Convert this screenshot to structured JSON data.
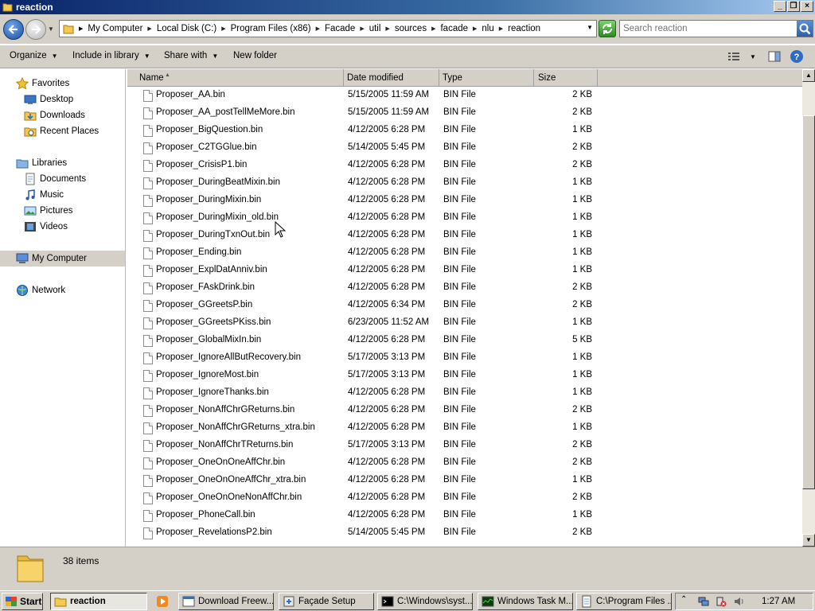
{
  "window": {
    "title": "reaction"
  },
  "address": {
    "crumbs": [
      "My Computer",
      "Local Disk (C:)",
      "Program Files (x86)",
      "Facade",
      "util",
      "sources",
      "facade",
      "nlu",
      "reaction"
    ]
  },
  "search": {
    "placeholder": "Search reaction"
  },
  "toolbar": {
    "organize": "Organize",
    "include_in_library": "Include in library",
    "share_with": "Share with",
    "new_folder": "New folder"
  },
  "nav": {
    "favorites": "Favorites",
    "desktop": "Desktop",
    "downloads": "Downloads",
    "recent_places": "Recent Places",
    "libraries": "Libraries",
    "documents": "Documents",
    "music": "Music",
    "pictures": "Pictures",
    "videos": "Videos",
    "my_computer": "My Computer",
    "network": "Network"
  },
  "columns": {
    "name": "Name",
    "date": "Date modified",
    "type": "Type",
    "size": "Size"
  },
  "files": [
    {
      "name": "Proposer_AA.bin",
      "date": "5/15/2005 11:59 AM",
      "type": "BIN File",
      "size": "2 KB"
    },
    {
      "name": "Proposer_AA_postTellMeMore.bin",
      "date": "5/15/2005 11:59 AM",
      "type": "BIN File",
      "size": "2 KB"
    },
    {
      "name": "Proposer_BigQuestion.bin",
      "date": "4/12/2005 6:28 PM",
      "type": "BIN File",
      "size": "1 KB"
    },
    {
      "name": "Proposer_C2TGGlue.bin",
      "date": "5/14/2005 5:45 PM",
      "type": "BIN File",
      "size": "2 KB"
    },
    {
      "name": "Proposer_CrisisP1.bin",
      "date": "4/12/2005 6:28 PM",
      "type": "BIN File",
      "size": "2 KB"
    },
    {
      "name": "Proposer_DuringBeatMixin.bin",
      "date": "4/12/2005 6:28 PM",
      "type": "BIN File",
      "size": "1 KB"
    },
    {
      "name": "Proposer_DuringMixin.bin",
      "date": "4/12/2005 6:28 PM",
      "type": "BIN File",
      "size": "1 KB"
    },
    {
      "name": "Proposer_DuringMixin_old.bin",
      "date": "4/12/2005 6:28 PM",
      "type": "BIN File",
      "size": "1 KB"
    },
    {
      "name": "Proposer_DuringTxnOut.bin",
      "date": "4/12/2005 6:28 PM",
      "type": "BIN File",
      "size": "1 KB"
    },
    {
      "name": "Proposer_Ending.bin",
      "date": "4/12/2005 6:28 PM",
      "type": "BIN File",
      "size": "1 KB"
    },
    {
      "name": "Proposer_ExplDatAnniv.bin",
      "date": "4/12/2005 6:28 PM",
      "type": "BIN File",
      "size": "1 KB"
    },
    {
      "name": "Proposer_FAskDrink.bin",
      "date": "4/12/2005 6:28 PM",
      "type": "BIN File",
      "size": "2 KB"
    },
    {
      "name": "Proposer_GGreetsP.bin",
      "date": "4/12/2005 6:34 PM",
      "type": "BIN File",
      "size": "2 KB"
    },
    {
      "name": "Proposer_GGreetsPKiss.bin",
      "date": "6/23/2005 11:52 AM",
      "type": "BIN File",
      "size": "1 KB"
    },
    {
      "name": "Proposer_GlobalMixIn.bin",
      "date": "4/12/2005 6:28 PM",
      "type": "BIN File",
      "size": "5 KB"
    },
    {
      "name": "Proposer_IgnoreAllButRecovery.bin",
      "date": "5/17/2005 3:13 PM",
      "type": "BIN File",
      "size": "1 KB"
    },
    {
      "name": "Proposer_IgnoreMost.bin",
      "date": "5/17/2005 3:13 PM",
      "type": "BIN File",
      "size": "1 KB"
    },
    {
      "name": "Proposer_IgnoreThanks.bin",
      "date": "4/12/2005 6:28 PM",
      "type": "BIN File",
      "size": "1 KB"
    },
    {
      "name": "Proposer_NonAffChrGReturns.bin",
      "date": "4/12/2005 6:28 PM",
      "type": "BIN File",
      "size": "2 KB"
    },
    {
      "name": "Proposer_NonAffChrGReturns_xtra.bin",
      "date": "4/12/2005 6:28 PM",
      "type": "BIN File",
      "size": "1 KB"
    },
    {
      "name": "Proposer_NonAffChrTReturns.bin",
      "date": "5/17/2005 3:13 PM",
      "type": "BIN File",
      "size": "2 KB"
    },
    {
      "name": "Proposer_OneOnOneAffChr.bin",
      "date": "4/12/2005 6:28 PM",
      "type": "BIN File",
      "size": "2 KB"
    },
    {
      "name": "Proposer_OneOnOneAffChr_xtra.bin",
      "date": "4/12/2005 6:28 PM",
      "type": "BIN File",
      "size": "1 KB"
    },
    {
      "name": "Proposer_OneOnOneNonAffChr.bin",
      "date": "4/12/2005 6:28 PM",
      "type": "BIN File",
      "size": "2 KB"
    },
    {
      "name": "Proposer_PhoneCall.bin",
      "date": "4/12/2005 6:28 PM",
      "type": "BIN File",
      "size": "1 KB"
    },
    {
      "name": "Proposer_RevelationsP2.bin",
      "date": "5/14/2005 5:45 PM",
      "type": "BIN File",
      "size": "2 KB"
    }
  ],
  "status": {
    "item_count": "38 items"
  },
  "taskbar": {
    "start": "Start",
    "tasks": [
      "reaction",
      "Download Freew...",
      "Façade Setup",
      "C:\\Windows\\syst...",
      "Windows Task M...",
      "C:\\Program Files ..."
    ],
    "clock": "1:27 AM"
  },
  "colors": {
    "title_bar": "#0a246a",
    "chrome": "#d4d0c8",
    "selection": "#d4d0c8"
  }
}
